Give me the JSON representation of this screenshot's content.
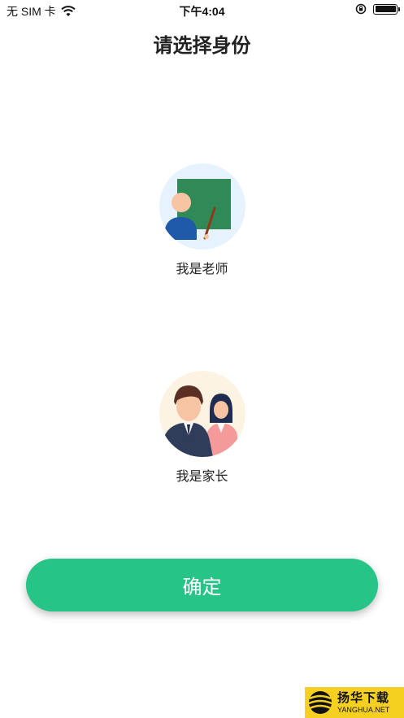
{
  "status_bar": {
    "carrier": "无 SIM 卡",
    "time": "下午4:04",
    "icons": [
      "wifi-icon",
      "orientation-lock-icon",
      "battery-icon"
    ]
  },
  "page": {
    "title": "请选择身份"
  },
  "roles": [
    {
      "label": "我是老师",
      "icon": "teacher-icon"
    },
    {
      "label": "我是家长",
      "icon": "parents-icon"
    }
  ],
  "confirm": {
    "label": "确定",
    "color": "#27c487"
  },
  "watermark": {
    "text_cn": "扬华下载",
    "text_en": "YANGHUA.NET"
  },
  "colors": {
    "background": "#ffffff",
    "accent": "#27c487",
    "teacher_avatar_bg": "#e6f2fd",
    "parent_avatar_bg": "#fdf3e3"
  }
}
